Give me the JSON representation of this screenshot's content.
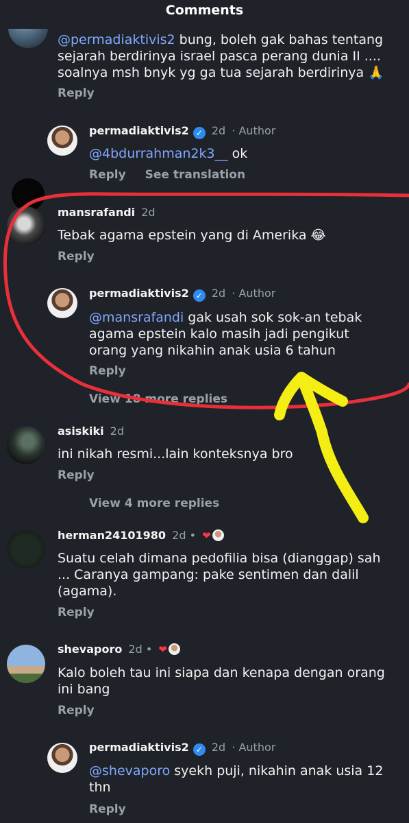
{
  "header": {
    "title": "Comments"
  },
  "comments": [
    {
      "text_mention": "@permadiaktivis2",
      "text_rest": " bung, boleh gak bahas tentang sejarah berdirinya israel pasca perang dunia II .... soalnya msh bnyk yg ga tua sejarah berdirinya 🙏",
      "reply": "Reply"
    },
    {
      "username": "permadiaktivis2",
      "time": "2d",
      "author_tag": "· Author",
      "text_mention": "@4bdurrahman2k3__",
      "text_rest": " ok",
      "reply": "Reply",
      "translate": "See translation"
    },
    {
      "username": "mansrafandi",
      "time": "2d",
      "text": "Tebak agama epstein yang di Amerika 😂",
      "reply": "Reply"
    },
    {
      "username": "permadiaktivis2",
      "time": "2d",
      "author_tag": "· Author",
      "text_mention": "@mansrafandi",
      "text_rest": " gak usah sok sok-an tebak agama epstein kalo masih jadi pengikut orang yang nikahin anak usia 6 tahun",
      "reply": "Reply"
    },
    {
      "view_more": "View 18 more replies"
    },
    {
      "username": "asiskiki",
      "time": "2d",
      "text": "ini nikah resmi...lain konteksnya bro",
      "reply": "Reply",
      "view_more": "View 4 more replies"
    },
    {
      "username": "herman24101980",
      "time": "2d •",
      "text": "Suatu celah dimana pedofilia bisa (dianggap) sah ... Caranya gampang: pake sentimen dan dalil (agama).",
      "reply": "Reply"
    },
    {
      "username": "shevaporo",
      "time": "2d •",
      "text": "Kalo boleh tau ini siapa dan kenapa dengan orang ini bang",
      "reply": "Reply"
    },
    {
      "username": "permadiaktivis2",
      "time": "2d",
      "author_tag": "· Author",
      "text_mention": "@shevaporo",
      "text_rest": " syekh puji, nikahin anak usia 12 thn",
      "reply": "Reply"
    }
  ],
  "icons": {
    "verified": "verified-badge-icon",
    "heart": "heart-icon"
  },
  "colors": {
    "background": "#1f2228",
    "mention": "#82a9ff",
    "annotation_red": "#e8303a",
    "annotation_yellow": "#f4ee14"
  }
}
